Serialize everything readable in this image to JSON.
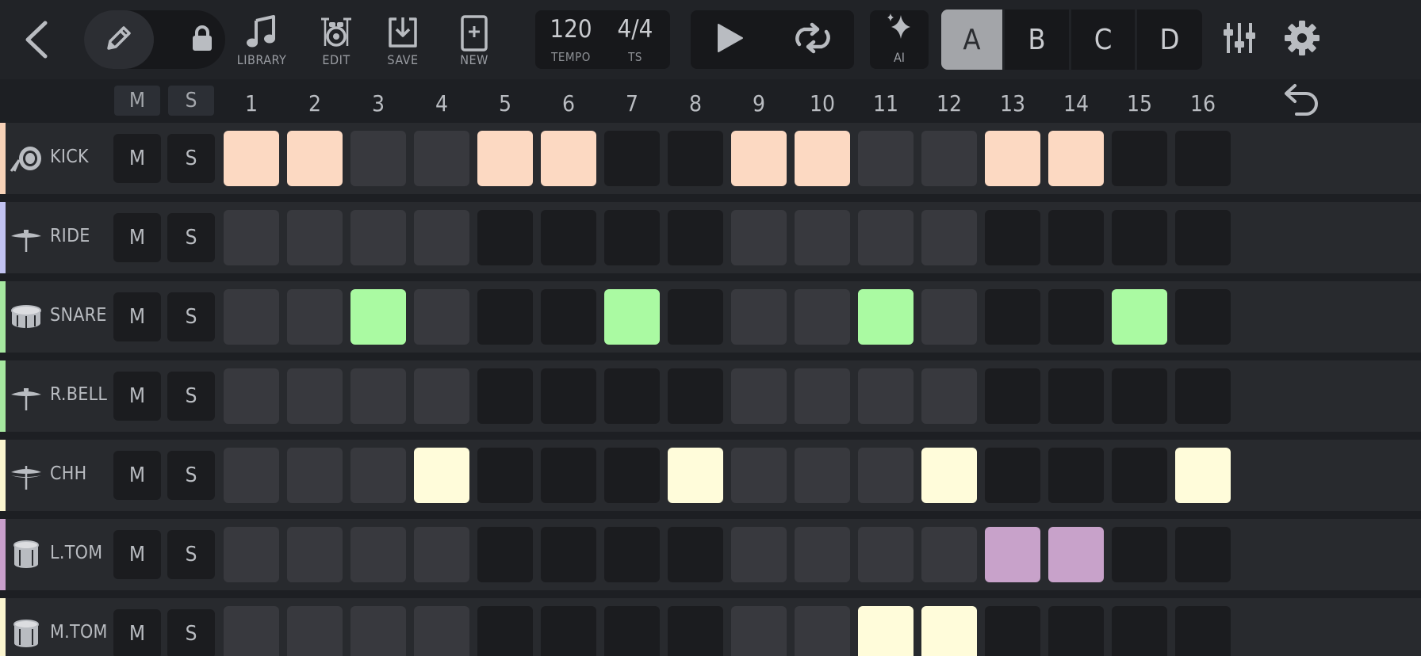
{
  "toolbar": {
    "tools": [
      {
        "id": "library",
        "label": "LIBRARY"
      },
      {
        "id": "edit",
        "label": "EDIT"
      },
      {
        "id": "save",
        "label": "SAVE"
      },
      {
        "id": "new",
        "label": "NEW"
      }
    ],
    "tempo": {
      "value": "120",
      "label": "TEMPO"
    },
    "time_signature": {
      "value": "4/4",
      "label": "TS"
    },
    "ai_label": "AI",
    "patterns": [
      "A",
      "B",
      "C",
      "D"
    ],
    "active_pattern": "A"
  },
  "header": {
    "mute_label": "M",
    "solo_label": "S",
    "steps": [
      "1",
      "2",
      "3",
      "4",
      "5",
      "6",
      "7",
      "8",
      "9",
      "10",
      "11",
      "12",
      "13",
      "14",
      "15",
      "16"
    ]
  },
  "icons": {
    "back": "chevron-left-icon",
    "pencil": "pencil-icon",
    "lock": "lock-icon",
    "library": "music-note-icon",
    "edit": "drum-kit-icon",
    "save": "save-icon",
    "new": "new-file-icon",
    "play": "play-icon",
    "loop": "loop-icon",
    "ai": "sparkle-icon",
    "mixer": "mixer-sliders-icon",
    "settings": "gear-icon",
    "undo": "undo-icon"
  },
  "colors": {
    "inactive_light": "#38393e",
    "inactive_dark": "#1b1c1f",
    "active_pattern": "#a3a5a9"
  },
  "tracks": [
    {
      "name": "KICK",
      "icon": "kick-drum-icon",
      "color": "#f7d2b8",
      "active_color": "#fcd9c2",
      "steps": [
        1,
        1,
        0,
        0,
        1,
        1,
        0,
        0,
        1,
        1,
        0,
        0,
        1,
        1,
        0,
        0
      ]
    },
    {
      "name": "RIDE",
      "icon": "cymbal-icon",
      "color": "#c2c3f2",
      "active_color": "#c2c3f2",
      "steps": [
        0,
        0,
        0,
        0,
        0,
        0,
        0,
        0,
        0,
        0,
        0,
        0,
        0,
        0,
        0,
        0
      ]
    },
    {
      "name": "SNARE",
      "icon": "snare-icon",
      "color": "#a6e8a0",
      "active_color": "#aafaa2",
      "steps": [
        0,
        0,
        1,
        0,
        0,
        0,
        1,
        0,
        0,
        0,
        1,
        0,
        0,
        0,
        1,
        0
      ]
    },
    {
      "name": "R.BELL",
      "icon": "cymbal-icon",
      "color": "#a6e8a0",
      "active_color": "#aafaa2",
      "steps": [
        0,
        0,
        0,
        0,
        0,
        0,
        0,
        0,
        0,
        0,
        0,
        0,
        0,
        0,
        0,
        0
      ]
    },
    {
      "name": "CHH",
      "icon": "hihat-icon",
      "color": "#fbf5cf",
      "active_color": "#fffcda",
      "steps": [
        0,
        0,
        0,
        1,
        0,
        0,
        0,
        1,
        0,
        0,
        0,
        1,
        0,
        0,
        0,
        1
      ]
    },
    {
      "name": "L.TOM",
      "icon": "tom-icon",
      "color": "#c9a0cc",
      "active_color": "#c8a2ca",
      "steps": [
        0,
        0,
        0,
        0,
        0,
        0,
        0,
        0,
        0,
        0,
        0,
        0,
        1,
        1,
        0,
        0
      ]
    },
    {
      "name": "M.TOM",
      "icon": "tom-icon",
      "color": "#fbf5cf",
      "active_color": "#fffcda",
      "steps": [
        0,
        0,
        0,
        0,
        0,
        0,
        0,
        0,
        0,
        0,
        1,
        1,
        0,
        0,
        0,
        0
      ]
    }
  ]
}
